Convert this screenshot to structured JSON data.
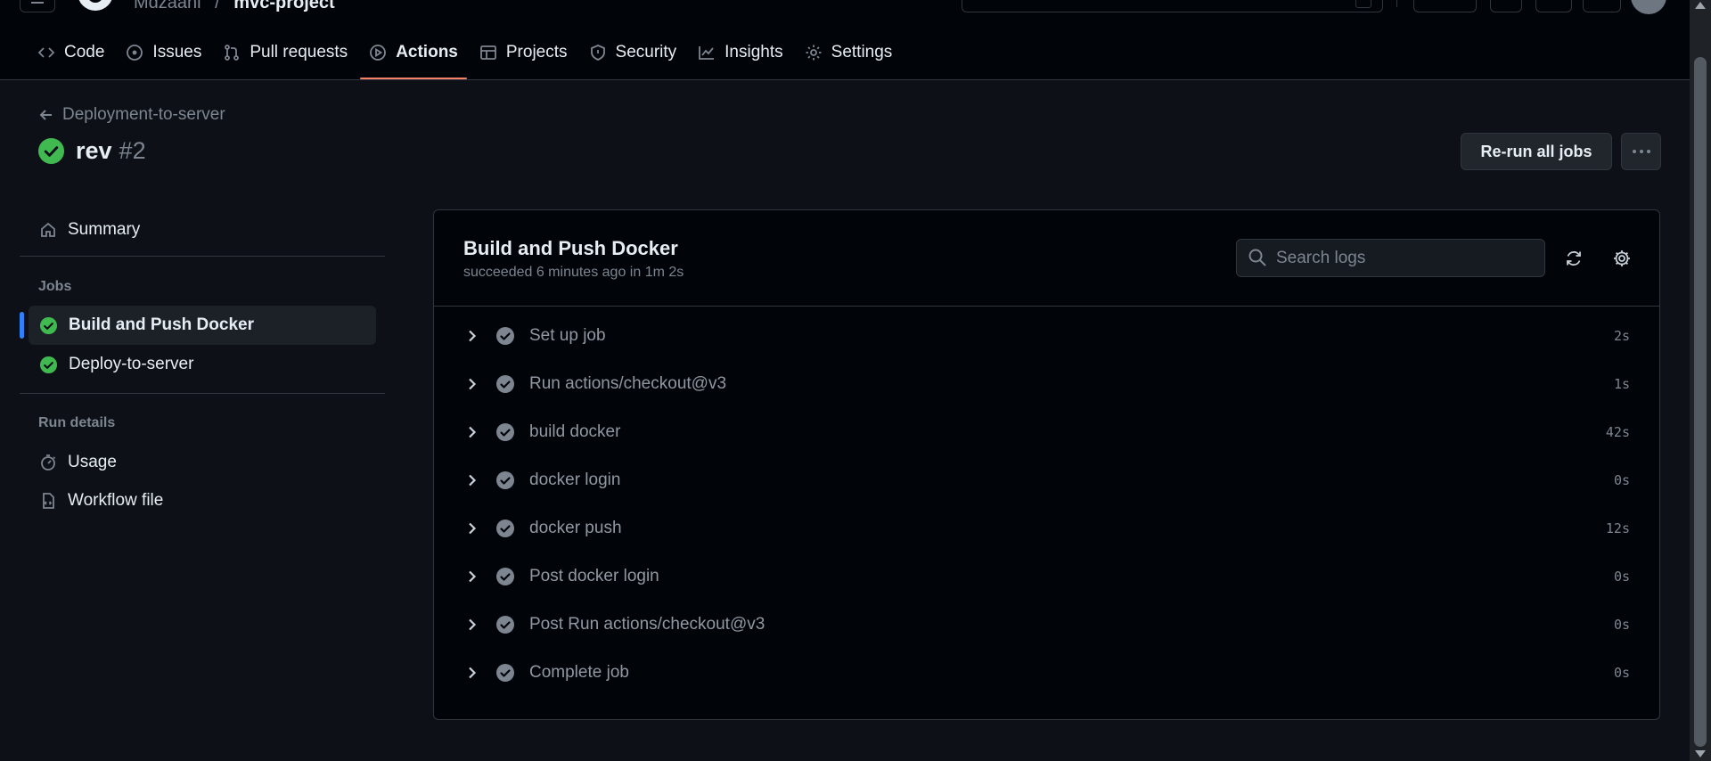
{
  "header": {
    "owner": "Mdzaahi",
    "separator": "/",
    "repo": "mvc-project"
  },
  "repo_nav": {
    "tabs": [
      {
        "label": "Code",
        "icon": "code-icon"
      },
      {
        "label": "Issues",
        "icon": "issue-opened-icon"
      },
      {
        "label": "Pull requests",
        "icon": "git-pull-request-icon"
      },
      {
        "label": "Actions",
        "icon": "play-icon",
        "active": true
      },
      {
        "label": "Projects",
        "icon": "table-icon"
      },
      {
        "label": "Security",
        "icon": "shield-icon"
      },
      {
        "label": "Insights",
        "icon": "graph-icon"
      },
      {
        "label": "Settings",
        "icon": "gear-icon"
      }
    ]
  },
  "run": {
    "back_label": "Deployment-to-server",
    "name": "rev",
    "number": "#2",
    "status": "success",
    "rerun_label": "Re-run all jobs"
  },
  "sidebar": {
    "summary_label": "Summary",
    "jobs_heading": "Jobs",
    "jobs": [
      {
        "label": "Build and Push Docker",
        "status": "success",
        "selected": true
      },
      {
        "label": "Deploy-to-server",
        "status": "success",
        "selected": false
      }
    ],
    "run_details_heading": "Run details",
    "usage_label": "Usage",
    "workflow_file_label": "Workflow file"
  },
  "job": {
    "title": "Build and Push Docker",
    "subtitle": "succeeded 6 minutes ago in 1m 2s",
    "search_placeholder": "Search logs",
    "steps": [
      {
        "name": "Set up job",
        "duration": "2s"
      },
      {
        "name": "Run actions/checkout@v3",
        "duration": "1s"
      },
      {
        "name": "build docker",
        "duration": "42s"
      },
      {
        "name": "docker login",
        "duration": "0s"
      },
      {
        "name": "docker push",
        "duration": "12s"
      },
      {
        "name": "Post docker login",
        "duration": "0s"
      },
      {
        "name": "Post Run actions/checkout@v3",
        "duration": "0s"
      },
      {
        "name": "Complete job",
        "duration": "0s"
      }
    ]
  },
  "colors": {
    "background": "#0d1117",
    "header_bg": "#010409",
    "border": "#30363d",
    "success": "#3fb950",
    "step_check": "#7d8590",
    "active_tab_underline": "#f78166",
    "selected_bar": "#2f81f7",
    "muted_text": "#7d8590"
  }
}
